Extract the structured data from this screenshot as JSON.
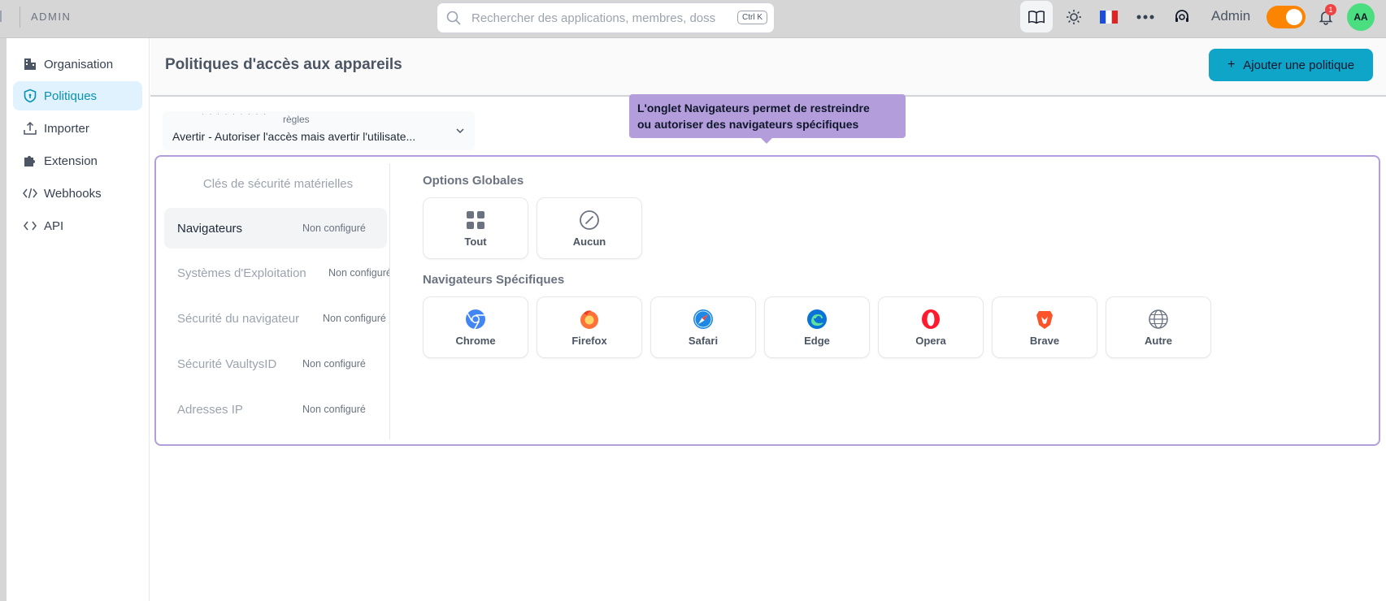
{
  "topbar": {
    "brand": "ADMIN",
    "search_placeholder": "Rechercher des applications, membres, doss",
    "shortcut": "Ctrl K",
    "user_label": "Admin",
    "notification_count": "1",
    "avatar_initials": "AA"
  },
  "sidebar": {
    "items": [
      {
        "label": "Organisation",
        "icon": "building-icon"
      },
      {
        "label": "Politiques",
        "icon": "shield-icon"
      },
      {
        "label": "Importer",
        "icon": "upload-icon"
      },
      {
        "label": "Extension",
        "icon": "puzzle-icon"
      },
      {
        "label": "Webhooks",
        "icon": "code-icon"
      },
      {
        "label": "API",
        "icon": "brackets-icon"
      }
    ]
  },
  "header": {
    "title": "Politiques d'accès aux appareils",
    "add_button": "Ajouter une politique"
  },
  "rules": {
    "label": "règles",
    "value": "Avertir - Autoriser l'accès mais avertir l'utilisate..."
  },
  "tooltip": {
    "line1": "L'onglet Navigateurs permet de restreindre",
    "line2": "ou autoriser des navigateurs spécifiques"
  },
  "tabs": [
    {
      "label": "Clés de sécurité matérielles",
      "status": ""
    },
    {
      "label": "Navigateurs",
      "status": "Non configuré"
    },
    {
      "label": "Systèmes d'Exploitation",
      "status": "Non configuré"
    },
    {
      "label": "Sécurité du navigateur",
      "status": "Non configuré"
    },
    {
      "label": "Sécurité VaultysID",
      "status": "Non configuré"
    },
    {
      "label": "Adresses IP",
      "status": "Non configuré"
    }
  ],
  "global_options": {
    "title": "Options Globales",
    "options": [
      {
        "label": "Tout",
        "icon": "grid-icon"
      },
      {
        "label": "Aucun",
        "icon": "slash-circle-icon"
      }
    ]
  },
  "specific": {
    "title": "Navigateurs Spécifiques",
    "browsers": [
      {
        "label": "Chrome",
        "icon": "chrome-icon",
        "color": "#4285f4"
      },
      {
        "label": "Firefox",
        "icon": "firefox-icon",
        "color": "#ff7139"
      },
      {
        "label": "Safari",
        "icon": "safari-icon",
        "color": "#1e88e5"
      },
      {
        "label": "Edge",
        "icon": "edge-icon",
        "color": "#0b73d6"
      },
      {
        "label": "Opera",
        "icon": "opera-icon",
        "color": "#ff1b2d"
      },
      {
        "label": "Brave",
        "icon": "brave-icon",
        "color": "#fb542b"
      },
      {
        "label": "Autre",
        "icon": "globe-icon",
        "color": "#6b7280"
      }
    ]
  },
  "colors": {
    "accent": "#0ea5c9",
    "highlight": "#b39ddb",
    "toggle": "#fb8500"
  }
}
